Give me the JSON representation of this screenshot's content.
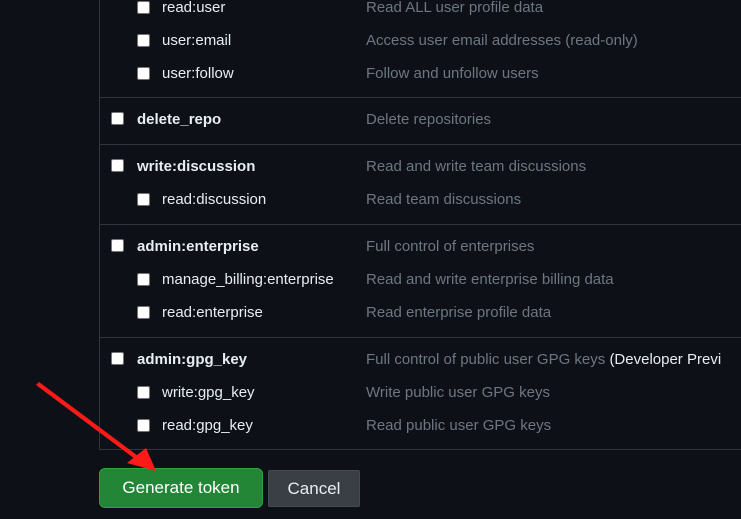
{
  "scopes": {
    "user_subscopes": [
      {
        "name": "read:user",
        "description": "Read ALL user profile data"
      },
      {
        "name": "user:email",
        "description": "Access user email addresses (read-only)"
      },
      {
        "name": "user:follow",
        "description": "Follow and unfollow users"
      }
    ],
    "delete_repo": {
      "name": "delete_repo",
      "description": "Delete repositories"
    },
    "write_discussion": {
      "name": "write:discussion",
      "description": "Read and write team discussions",
      "children": [
        {
          "name": "read:discussion",
          "description": "Read team discussions"
        }
      ]
    },
    "admin_enterprise": {
      "name": "admin:enterprise",
      "description": "Full control of enterprises",
      "children": [
        {
          "name": "manage_billing:enterprise",
          "description": "Read and write enterprise billing data"
        },
        {
          "name": "read:enterprise",
          "description": "Read enterprise profile data"
        }
      ]
    },
    "admin_gpg_key": {
      "name": "admin:gpg_key",
      "description": "Full control of public user GPG keys",
      "description_note": "(Developer Previ",
      "children": [
        {
          "name": "write:gpg_key",
          "description": "Write public user GPG keys"
        },
        {
          "name": "read:gpg_key",
          "description": "Read public user GPG keys"
        }
      ]
    }
  },
  "actions": {
    "generate_label": "Generate token",
    "cancel_label": "Cancel"
  },
  "colors": {
    "background": "#0d1117",
    "text": "#e6edf3",
    "muted": "#6e7681",
    "border": "#30363d",
    "primary_button": "#238636",
    "secondary_button": "#3a3f45",
    "annotation_arrow": "#ff1a1a"
  },
  "annotation": {
    "icon": "red-arrow-icon"
  }
}
